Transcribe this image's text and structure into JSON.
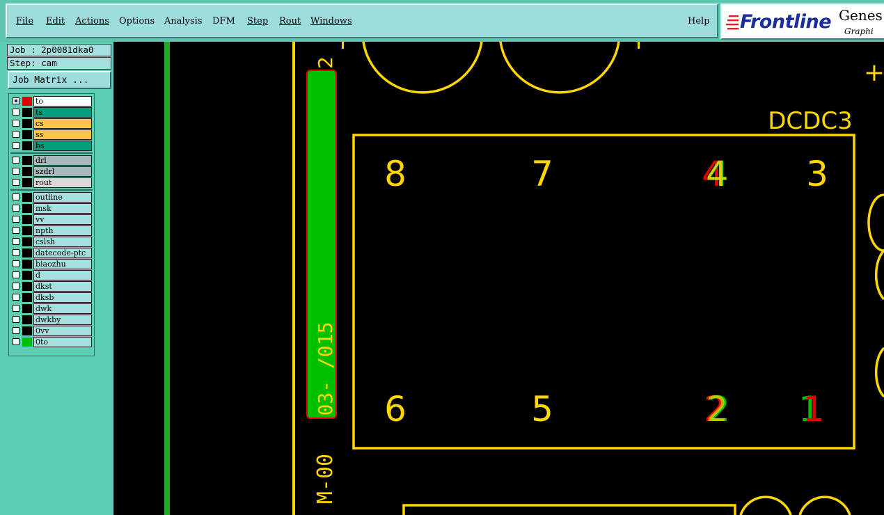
{
  "menu": {
    "items": [
      "File",
      "Edit",
      "Actions",
      "Options",
      "Analysis",
      "DFM",
      "Step",
      "Rout",
      "Windows"
    ],
    "help": "Help"
  },
  "logo": {
    "brand": "Frontline",
    "product": "Genes",
    "sub": "Graphi"
  },
  "job": {
    "job_label": "Job : 2p0081dka0",
    "step_label": "Step: cam",
    "matrix_button": "Job Matrix ..."
  },
  "layers": [
    {
      "name": "to",
      "color": "#ffffff",
      "swatch": "#e00000",
      "checked": true
    },
    {
      "name": "ts",
      "color": "#009e7a",
      "swatch": "#000000",
      "checked": false
    },
    {
      "name": "cs",
      "color": "#ffc24a",
      "swatch": "#000000",
      "checked": false
    },
    {
      "name": "ss",
      "color": "#ffc24a",
      "swatch": "#000000",
      "checked": false
    },
    {
      "name": "bs",
      "color": "#009e7a",
      "swatch": "#000000",
      "checked": false
    },
    {
      "name": "drl",
      "color": "#a8b7bb",
      "swatch": "#000000",
      "checked": false
    },
    {
      "name": "szdrl",
      "color": "#a8b7bb",
      "swatch": "#000000",
      "checked": false
    },
    {
      "name": "rout",
      "color": "#d9d9d9",
      "swatch": "#000000",
      "checked": false
    },
    {
      "name": "outline",
      "color": "#a6e0de",
      "swatch": "#000000",
      "checked": false
    },
    {
      "name": "msk",
      "color": "#a6e0de",
      "swatch": "#000000",
      "checked": false
    },
    {
      "name": "vv",
      "color": "#a6e0de",
      "swatch": "#000000",
      "checked": false
    },
    {
      "name": "npth",
      "color": "#a6e0de",
      "swatch": "#000000",
      "checked": false
    },
    {
      "name": "cslsh",
      "color": "#a6e0de",
      "swatch": "#000000",
      "checked": false
    },
    {
      "name": "datecode-ptc",
      "color": "#a6e0de",
      "swatch": "#000000",
      "checked": false
    },
    {
      "name": "biaozhu",
      "color": "#a6e0de",
      "swatch": "#000000",
      "checked": false
    },
    {
      "name": "d",
      "color": "#a6e0de",
      "swatch": "#000000",
      "checked": false
    },
    {
      "name": "dkst",
      "color": "#a6e0de",
      "swatch": "#000000",
      "checked": false
    },
    {
      "name": "dksb",
      "color": "#a6e0de",
      "swatch": "#000000",
      "checked": false
    },
    {
      "name": "dwk",
      "color": "#a6e0de",
      "swatch": "#000000",
      "checked": false
    },
    {
      "name": "dwkby",
      "color": "#a6e0de",
      "swatch": "#000000",
      "checked": false
    },
    {
      "name": "0vv",
      "color": "#a6e0de",
      "swatch": "#000000",
      "checked": false
    },
    {
      "name": "0to",
      "color": "#a6e0de",
      "swatch": "#00c000",
      "checked": false
    }
  ],
  "canvas": {
    "component_label": "DCDC3",
    "pin_numbers": [
      "8",
      "7",
      "4",
      "3",
      "6",
      "5",
      "2",
      "1"
    ],
    "vertical_text_green": "03-  /015",
    "vertical_text_left": "M-00",
    "top_digit": "2",
    "plus_mark": "+",
    "colors": {
      "silkscreen": "#ffd700",
      "top_copper": "#e00000",
      "green": "#00c000",
      "panel": "#5fcdb2"
    }
  }
}
